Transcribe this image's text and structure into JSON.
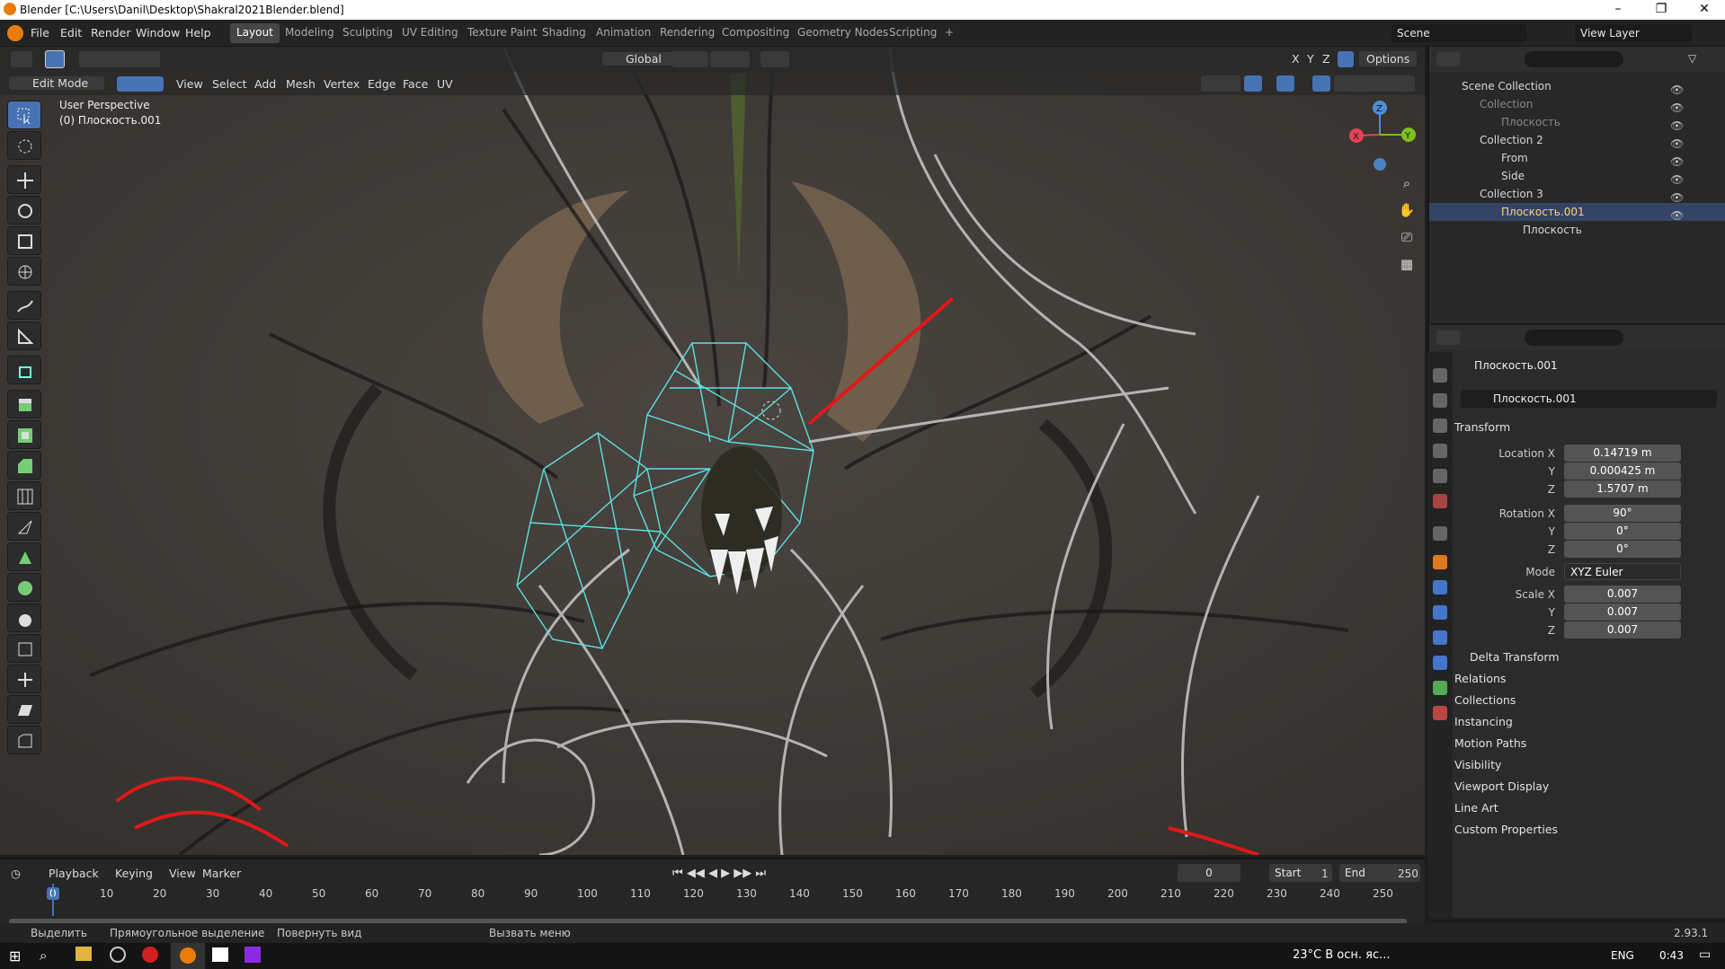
{
  "window": {
    "title": "Blender [C:\\Users\\Danil\\Desktop\\Shakral2021Blender.blend]",
    "minimize": "–",
    "maximize": "❐",
    "close": "✕"
  },
  "menubar": {
    "items": [
      "File",
      "Edit",
      "Render",
      "Window",
      "Help"
    ]
  },
  "workspaces": [
    {
      "label": "Layout",
      "active": true
    },
    {
      "label": "Modeling"
    },
    {
      "label": "Sculpting"
    },
    {
      "label": "UV Editing"
    },
    {
      "label": "Texture Paint"
    },
    {
      "label": "Shading"
    },
    {
      "label": "Animation"
    },
    {
      "label": "Rendering"
    },
    {
      "label": "Compositing"
    },
    {
      "label": "Geometry Nodes"
    },
    {
      "label": "Scripting"
    },
    {
      "label": "+"
    }
  ],
  "scene": {
    "label": "Scene",
    "view_layer": "View Layer"
  },
  "viewport_header": {
    "transform_orientation": "Global",
    "axes": [
      "X",
      "Y",
      "Z"
    ],
    "options": "Options",
    "mode": "Edit Mode",
    "menus": [
      "View",
      "Select",
      "Add",
      "Mesh",
      "Vertex",
      "Edge",
      "Face",
      "UV"
    ]
  },
  "viewport": {
    "perspective": "User Perspective",
    "object": "(0) Плоскость.001",
    "gizmo_axes": [
      "X",
      "Y",
      "Z"
    ]
  },
  "outliner": {
    "rows": [
      {
        "label": "Scene Collection",
        "indent": 0
      },
      {
        "label": "Collection",
        "indent": 1,
        "dim": true
      },
      {
        "label": "Плоскость",
        "indent": 2,
        "dim": true
      },
      {
        "label": "Collection 2",
        "indent": 1
      },
      {
        "label": "From",
        "indent": 2
      },
      {
        "label": "Side",
        "indent": 2
      },
      {
        "label": "Collection 3",
        "indent": 1
      },
      {
        "label": "Плоскость.001",
        "indent": 2
      },
      {
        "label": "Плоскость",
        "indent": 3
      }
    ]
  },
  "properties": {
    "object_name": "Плоскость.001",
    "datablock": "Плоскость.001",
    "transform_header": "Transform",
    "location": {
      "label": "Location X",
      "x": "0.14719 m",
      "y": "0.000425 m",
      "z": "1.5707 m"
    },
    "rotation": {
      "label": "Rotation X",
      "x": "90°",
      "y": "0°",
      "z": "0°"
    },
    "mode": {
      "label": "Mode",
      "value": "XYZ Euler"
    },
    "scale": {
      "label": "Scale X",
      "x": "0.007",
      "y": "0.007",
      "z": "0.007"
    },
    "axis_y": "Y",
    "axis_z": "Z",
    "delta": "Delta Transform",
    "panels": [
      "Relations",
      "Collections",
      "Instancing",
      "Motion Paths",
      "Visibility",
      "Viewport Display",
      "Line Art",
      "Custom Properties"
    ]
  },
  "timeline": {
    "menus": [
      "Playback",
      "Keying",
      "View",
      "Marker"
    ],
    "current_frame": "0",
    "start_label": "Start",
    "start": "1",
    "end_label": "End",
    "end": "250",
    "ticks": [
      "0",
      "10",
      "20",
      "30",
      "40",
      "50",
      "60",
      "70",
      "80",
      "90",
      "100",
      "110",
      "120",
      "130",
      "140",
      "150",
      "160",
      "170",
      "180",
      "190",
      "200",
      "210",
      "220",
      "230",
      "240",
      "250"
    ]
  },
  "statusbar": {
    "select": "Выделить",
    "box": "Прямоугольное выделение",
    "rotate": "Повернуть вид",
    "menu": "Вызвать меню",
    "version": "2.93.1"
  },
  "taskbar": {
    "weather": "23°C  В осн. яс...",
    "lang": "ENG",
    "time": "0:43"
  }
}
